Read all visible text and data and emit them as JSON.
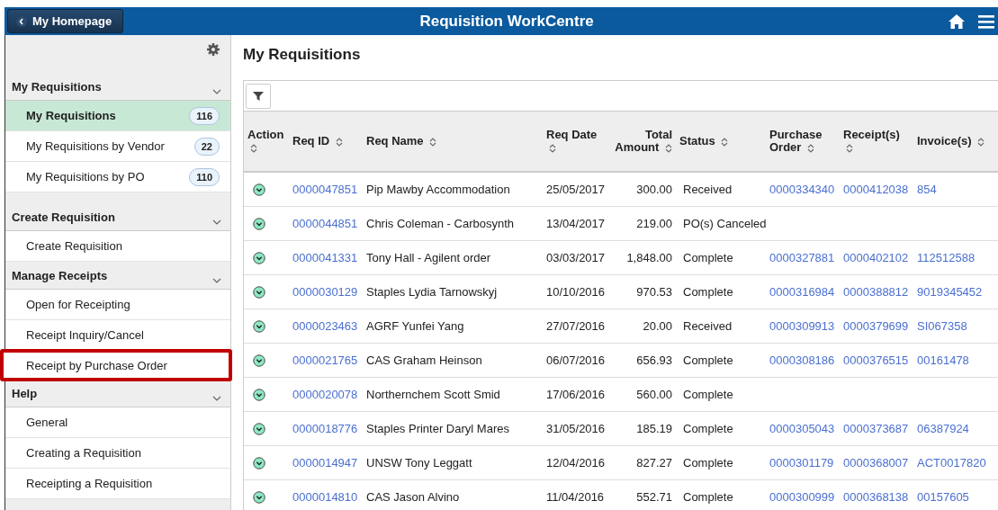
{
  "header": {
    "back_button": "My Homepage",
    "title": "Requisition WorkCentre"
  },
  "sidebar": {
    "groups": [
      {
        "title": "My Requisitions",
        "items": [
          {
            "label": "My Requisitions",
            "count": "116",
            "selected": true,
            "highlighted": false
          },
          {
            "label": "My Requisitions by Vendor",
            "count": "22",
            "selected": false,
            "highlighted": false
          },
          {
            "label": "My Requisitions by PO",
            "count": "110",
            "selected": false,
            "highlighted": false
          }
        ]
      },
      {
        "title": "Create Requisition",
        "items": [
          {
            "label": "Create Requisition",
            "selected": false,
            "highlighted": false
          }
        ]
      },
      {
        "title": "Manage Receipts",
        "items": [
          {
            "label": "Open for Receipting",
            "selected": false,
            "highlighted": false
          },
          {
            "label": "Receipt Inquiry/Cancel",
            "selected": false,
            "highlighted": false
          },
          {
            "label": "Receipt by Purchase Order",
            "selected": false,
            "highlighted": true
          }
        ]
      },
      {
        "title": "Help",
        "items": [
          {
            "label": "General",
            "selected": false,
            "highlighted": false
          },
          {
            "label": "Creating a Requisition",
            "selected": false,
            "highlighted": false
          },
          {
            "label": "Receipting a Requisition",
            "selected": false,
            "highlighted": false
          }
        ]
      }
    ]
  },
  "page_title": "My Requisitions",
  "table": {
    "columns": [
      {
        "label": "Action"
      },
      {
        "label": "Req ID"
      },
      {
        "label": "Req Name"
      },
      {
        "label": "Req Date"
      },
      {
        "label": "Total Amount"
      },
      {
        "label": "Status"
      },
      {
        "label": "Purchase Order"
      },
      {
        "label": "Receipt(s)"
      },
      {
        "label": "Invoice(s)"
      }
    ],
    "rows": [
      {
        "req_id": "0000047851",
        "req_name": "Pip Mawby Accommodation",
        "req_date": "25/05/2017",
        "total": "300.00",
        "status": "Received",
        "po": "0000334340",
        "receipts": "0000412038",
        "invoices": "854"
      },
      {
        "req_id": "0000044851",
        "req_name": "Chris Coleman - Carbosynth",
        "req_date": "13/04/2017",
        "total": "219.00",
        "status": "PO(s) Canceled"
      },
      {
        "req_id": "0000041331",
        "req_name": "Tony Hall - Agilent order",
        "req_date": "03/03/2017",
        "total": "1,848.00",
        "status": "Complete",
        "po": "0000327881",
        "receipts": "0000402102",
        "invoices": "112512588"
      },
      {
        "req_id": "0000030129",
        "req_name": "Staples Lydia Tarnowskyj",
        "req_date": "10/10/2016",
        "total": "970.53",
        "status": "Complete",
        "po": "0000316984",
        "receipts": "0000388812",
        "invoices": "9019345452"
      },
      {
        "req_id": "0000023463",
        "req_name": "AGRF Yunfei Yang",
        "req_date": "27/07/2016",
        "total": "20.00",
        "status": "Received",
        "po": "0000309913",
        "receipts": "0000379699",
        "invoices": "SI067358"
      },
      {
        "req_id": "0000021765",
        "req_name": "CAS Graham Heinson",
        "req_date": "06/07/2016",
        "total": "656.93",
        "status": "Complete",
        "po": "0000308186",
        "receipts": "0000376515",
        "invoices": "00161478"
      },
      {
        "req_id": "0000020078",
        "req_name": "Northernchem Scott Smid",
        "req_date": "17/06/2016",
        "total": "560.00",
        "status": "Complete"
      },
      {
        "req_id": "0000018776",
        "req_name": "Staples Printer Daryl Mares",
        "req_date": "31/05/2016",
        "total": "185.19",
        "status": "Complete",
        "po": "0000305043",
        "receipts": "0000373687",
        "invoices": "06387924"
      },
      {
        "req_id": "0000014947",
        "req_name": "UNSW Tony Leggatt",
        "req_date": "12/04/2016",
        "total": "827.27",
        "status": "Complete",
        "po": "0000301179",
        "receipts": "0000368007",
        "invoices": "ACT0017820"
      },
      {
        "req_id": "0000014810",
        "req_name": "CAS Jason Alvino",
        "req_date": "11/04/2016",
        "total": "552.71",
        "status": "Complete",
        "po": "0000300999",
        "receipts": "0000368138",
        "invoices": "00157605"
      }
    ]
  }
}
